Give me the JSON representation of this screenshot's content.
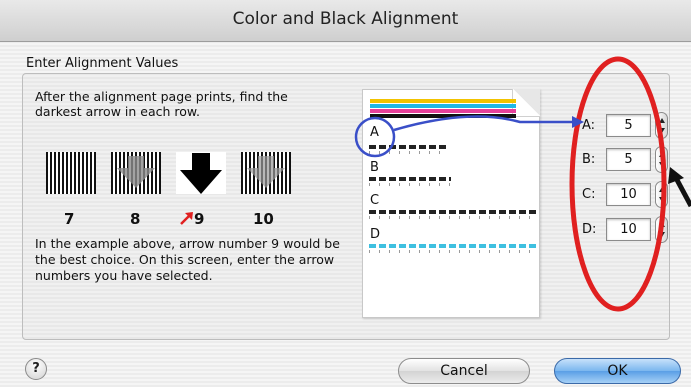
{
  "window": {
    "title": "Color and Black Alignment"
  },
  "section": {
    "label": "Enter Alignment Values"
  },
  "instructions": {
    "text": "After the alignment page prints, find the darkest arrow in each row."
  },
  "example": {
    "arrow_numbers": [
      "7",
      "8",
      "9",
      "10"
    ],
    "selected": "9",
    "text": "In the example above, arrow number 9 would be the best choice. On this screen, enter the arrow numbers you have selected."
  },
  "sample_page": {
    "color_bars": [
      "#f2c300",
      "#1fb8e6",
      "#e6409a",
      "#111111"
    ],
    "rows": [
      "A",
      "B",
      "C",
      "D"
    ]
  },
  "fields": [
    {
      "label": "A:",
      "value": "5"
    },
    {
      "label": "B:",
      "value": "5"
    },
    {
      "label": "C:",
      "value": "10"
    },
    {
      "label": "D:",
      "value": "10"
    }
  ],
  "buttons": {
    "help": "?",
    "cancel": "Cancel",
    "ok": "OK"
  },
  "colors": {
    "highlight_red": "#e02020",
    "callout_blue": "#3a4fc8",
    "ok_button_blue": "#5a9fe6"
  }
}
